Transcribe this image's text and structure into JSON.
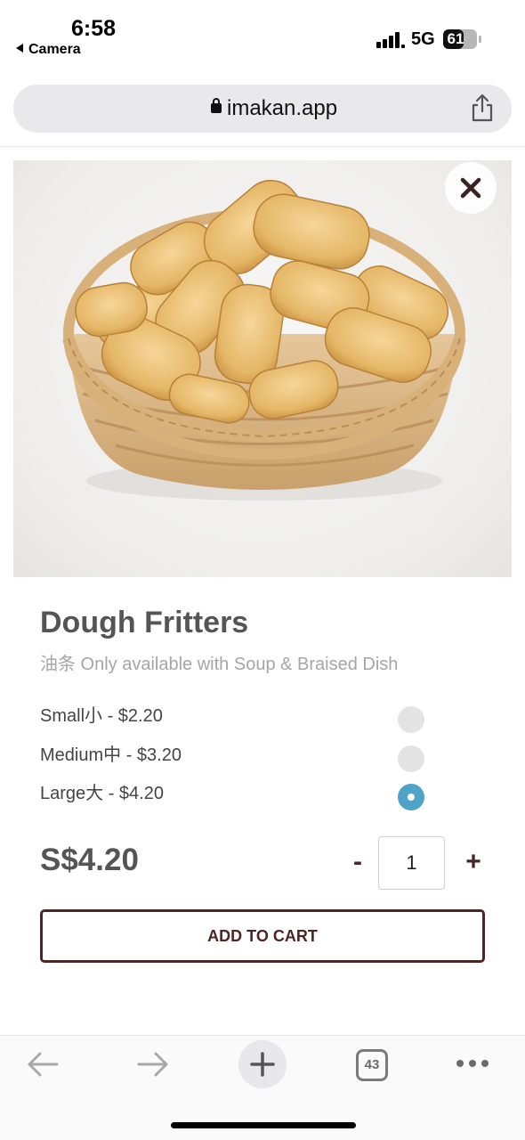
{
  "status_bar": {
    "time": "6:58",
    "back_app": "Camera",
    "network": "5G",
    "battery": "61",
    "battery_level": 0.61
  },
  "browser": {
    "url": "imakan.app",
    "tabs_count": "43"
  },
  "product": {
    "title": "Dough Fritters",
    "subtitle": "油条 Only available with Soup & Braised Dish",
    "options": [
      {
        "label": "Small小 - $2.20",
        "selected": false
      },
      {
        "label": "Medium中 - $3.20",
        "selected": false
      },
      {
        "label": "Large大 - $4.20",
        "selected": true
      }
    ],
    "price": "S$4.20",
    "quantity": "1",
    "minus_label": "-",
    "plus_label": "+",
    "add_to_cart_label": "ADD TO CART"
  },
  "colors": {
    "accent": "#4a2626",
    "radio_selected": "#4fa3c7",
    "radio_unselected": "#e3e3e3"
  },
  "icons": [
    "lock-icon",
    "share-icon",
    "close-icon",
    "back-arrow-icon",
    "forward-arrow-icon",
    "new-tab-plus-icon",
    "tabs-icon",
    "more-icon"
  ]
}
